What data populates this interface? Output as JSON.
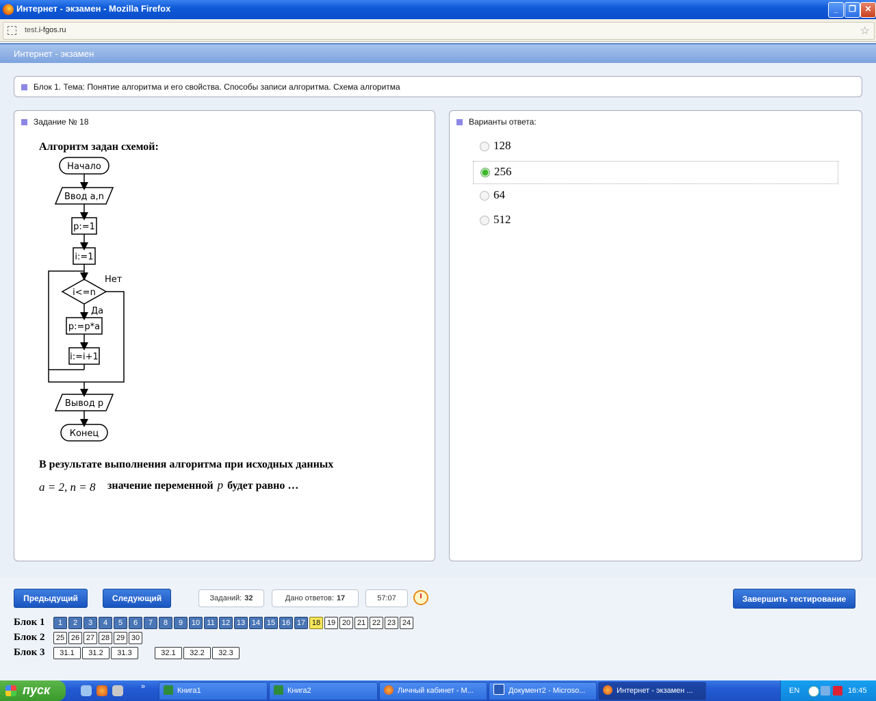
{
  "window": {
    "title": "Интернет - экзамен - Mozilla Firefox",
    "url": "test.i-fgos.ru",
    "url_host": "test.",
    "url_domain": "i-fgos.ru"
  },
  "app": {
    "header": "Интернет - экзамен"
  },
  "block_title": "Блок 1. Тема: Понятие алгоритма и его свойства. Способы записи алгоритма. Схема алгоритма",
  "task": {
    "heading": "Задание № 18",
    "intro": "Алгоритм задан схемой:",
    "flow": {
      "start": "Начало",
      "input": "Ввод a,n",
      "init_p": "p:=1",
      "init_i": "i:=1",
      "cond": "i<=n",
      "no": "Нет",
      "yes": "Да",
      "body": "p:=p*a",
      "incr": "i:=i+1",
      "output": "Вывод p",
      "end": "Конец"
    },
    "text1": "В результате выполнения алгоритма при исходных данных",
    "formula": "a = 2, n = 8",
    "text2_a": "значение переменной",
    "text2_var": "p",
    "text2_b": "будет равно …"
  },
  "answers": {
    "heading": "Варианты ответа:",
    "options": [
      {
        "label": "128",
        "selected": false
      },
      {
        "label": "256",
        "selected": true
      },
      {
        "label": "64",
        "selected": false
      },
      {
        "label": "512",
        "selected": false
      }
    ]
  },
  "nav": {
    "prev": "Предыдущий",
    "next": "Следующий",
    "tasks_label": "Заданий:",
    "tasks_value": "32",
    "answered_label": "Дано ответов:",
    "answered_value": "17",
    "timer": "57:07",
    "finish": "Завершить тестирование"
  },
  "blocks": [
    {
      "label": "Блок 1",
      "items": [
        "1",
        "2",
        "3",
        "4",
        "5",
        "6",
        "7",
        "8",
        "9",
        "10",
        "11",
        "12",
        "13",
        "14",
        "15",
        "16",
        "17",
        "18",
        "19",
        "20",
        "21",
        "22",
        "23",
        "24"
      ]
    },
    {
      "label": "Блок 2",
      "items": [
        "25",
        "26",
        "27",
        "28",
        "29",
        "30"
      ]
    },
    {
      "label": "Блок 3",
      "items": [
        "31.1",
        "31.2",
        "31.3",
        "32.1",
        "32.2",
        "32.3"
      ]
    }
  ],
  "current_task": "18",
  "answered_count": 17,
  "taskbar": {
    "start": "пуск",
    "apps": [
      "Книга1",
      "Книга2",
      "Личный кабинет - М...",
      "Документ2 - Microso...",
      "Интернет - экзамен ..."
    ],
    "lang": "EN",
    "time": "16:45"
  },
  "colors": {
    "done_cell": "#4a76b6",
    "current_cell": "#f5e65c",
    "accent_square": "#8c87e6",
    "selected_radio": "#3cb82a"
  }
}
